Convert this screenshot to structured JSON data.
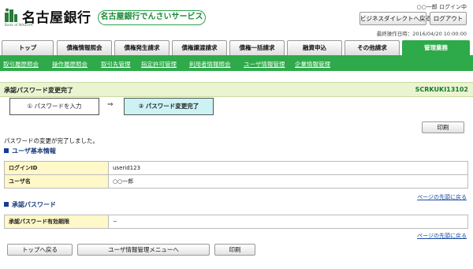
{
  "header": {
    "bank_name": "名古屋銀行",
    "logo_sub": "Bank of NAGOYA",
    "service_name": "名古屋銀行でんさいサービス",
    "user_status": "○○一郎 ログイン中",
    "ds_button": "ビジネスダイレクトへ戻る",
    "logout_button": "ログアウト",
    "last_operation": "最終操作日時：2016/04/20 10:00:00"
  },
  "tabs": [
    {
      "label": "トップ"
    },
    {
      "label": "債権情報照会"
    },
    {
      "label": "債権発生請求"
    },
    {
      "label": "債権譲渡請求"
    },
    {
      "label": "債権一括請求"
    },
    {
      "label": "融資申込"
    },
    {
      "label": "その他請求"
    },
    {
      "label": "管理業務"
    }
  ],
  "submenu": [
    {
      "label": "取引履歴照会"
    },
    {
      "label": "操作履歴照会"
    },
    {
      "label": "取引先管理"
    },
    {
      "label": "指定許可管理"
    },
    {
      "label": "利用者情報照会"
    },
    {
      "label": "ユーザ情報管理"
    },
    {
      "label": "企業情報管理"
    }
  ],
  "page": {
    "title": "承認パスワード変更完了",
    "screen_id": "SCRKUKI13102",
    "steps": [
      {
        "label": "① パスワードを入力"
      },
      {
        "label": "② パスワード変更完了"
      }
    ],
    "step_arrow": "⇒",
    "print_label": "印刷",
    "message": "パスワードの変更が完了しました。"
  },
  "user_info": {
    "heading": "ユーザ基本情報",
    "rows": [
      {
        "label": "ログインID",
        "value": "userid123"
      },
      {
        "label": "ユーザ名",
        "value": "○○一郎"
      }
    ]
  },
  "approval_password": {
    "heading": "承認パスワード",
    "rows": [
      {
        "label": "承認パスワード有効期限",
        "value": "−"
      }
    ]
  },
  "links": {
    "page_top": "ページの先頭に戻る"
  },
  "footer_buttons": {
    "back_top": "トップへ戻る",
    "user_menu": "ユーザ情報管理メニューへ",
    "print": "印刷"
  },
  "colors": {
    "brand_green": "#2eaa4a",
    "title_bg": "#eaf4d0",
    "active_step_bg": "#ccf2f4",
    "label_bg": "#fff8c8",
    "link_blue": "#1a4aa0"
  }
}
